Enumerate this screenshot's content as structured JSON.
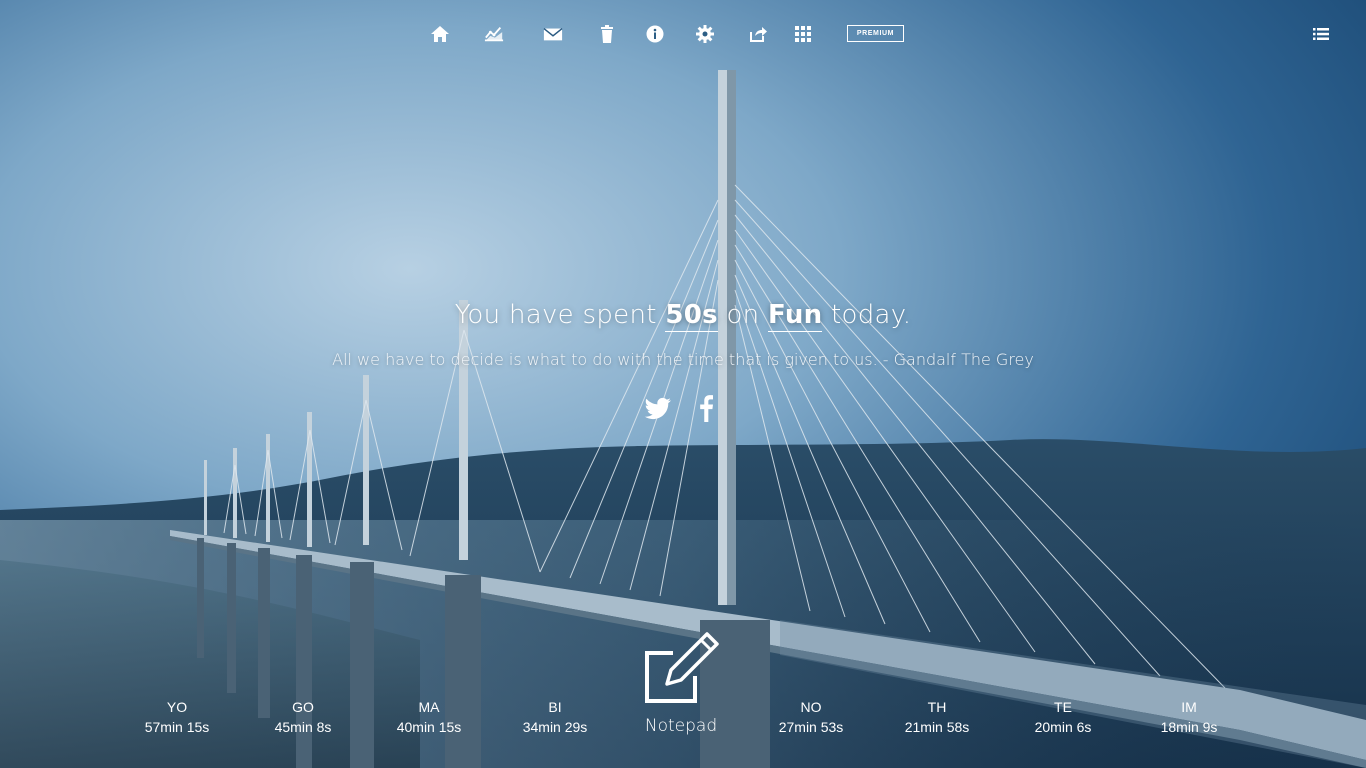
{
  "toolbar": {
    "icons": [
      "home-icon",
      "chart-icon",
      "mail-icon",
      "trash-icon",
      "info-icon",
      "gear-icon",
      "share-icon",
      "apps-grid-icon"
    ],
    "premium_label": "PREMIUM",
    "menu_icon": "list-menu-icon"
  },
  "headline": {
    "prefix": "You have spent",
    "duration": "50s",
    "connector": "on",
    "category": "Fun",
    "suffix": "today."
  },
  "quote": "All we have to decide is what to do with the time that is given to us. - Gandalf The Grey",
  "social": {
    "twitter_icon": "twitter-icon",
    "facebook_icon": "facebook-icon"
  },
  "stats": [
    {
      "abbr": "YO",
      "time": "57min 15s"
    },
    {
      "abbr": "GO",
      "time": "45min 8s"
    },
    {
      "abbr": "MA",
      "time": "40min 15s"
    },
    {
      "abbr": "BI",
      "time": "34min 29s"
    },
    {
      "abbr": "NO",
      "time": "27min 53s"
    },
    {
      "abbr": "TH",
      "time": "21min 58s"
    },
    {
      "abbr": "TE",
      "time": "20min 6s"
    },
    {
      "abbr": "IM",
      "time": "18min 9s"
    }
  ],
  "notepad": {
    "label": "Notepad",
    "icon": "edit-note-icon"
  },
  "colors": {
    "sky_top": "#1d4a72",
    "sky_light": "#a9c6dc",
    "hills": "#1e3b52",
    "text": "#ffffff"
  }
}
